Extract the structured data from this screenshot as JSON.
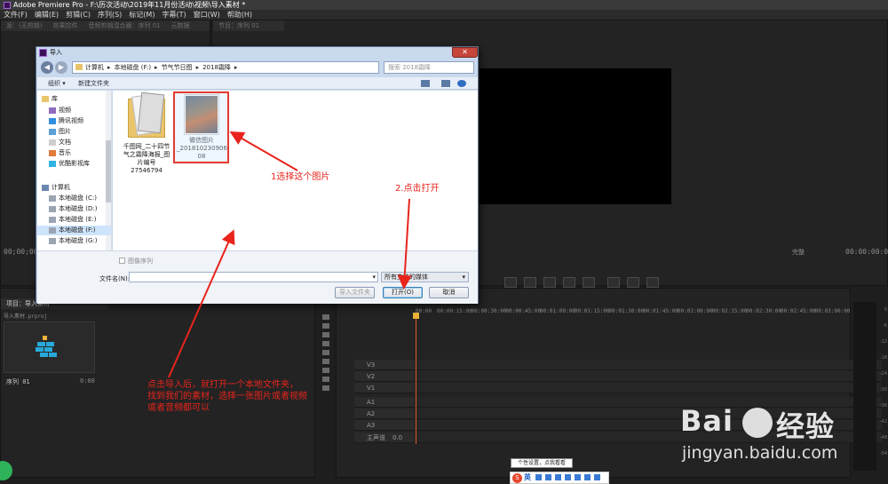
{
  "app": {
    "title": "Adobe Premiere Pro - F:\\历次活动\\2019年11月份活动\\视频\\导入素材 *",
    "menu": [
      "文件(F)",
      "编辑(E)",
      "剪辑(C)",
      "序列(S)",
      "标记(M)",
      "字幕(T)",
      "窗口(W)",
      "帮助(H)"
    ]
  },
  "premiere": {
    "source_tabs": [
      "源：(无剪辑)",
      "效果控件",
      "音频剪辑混合器：序列 01",
      "元数据"
    ],
    "program_tab": "节目：序列 01",
    "source_timecode": "00;00;00;00",
    "program_timecode_left": "00;00;00;00",
    "program_timecode_right": "00:00:00:00",
    "program_fit": "完整",
    "project_tab": "项目：导入素材",
    "project_item": "导入素材.prproj",
    "sequence_label": "序列 01",
    "sequence_duration": "0:00",
    "timeline_ruler": [
      "00:00",
      "00:00:15:00",
      "00:00:30:00",
      "00:00:45:00",
      "00:01:00:00",
      "00:01:15:00",
      "00:01:30:00",
      "00:01:45:00",
      "00:02:00:00",
      "00:02:15:00",
      "00:02:30:00",
      "00:02:45:00",
      "00:03:00:00"
    ],
    "tracks": [
      "V3",
      "V2",
      "V1",
      "A1",
      "A2",
      "A3",
      "主声道"
    ],
    "master_value": "0.0",
    "meter_db": [
      "0",
      "-6",
      "-12",
      "-18",
      "-24",
      "-30",
      "-36",
      "-42",
      "-48",
      "-54"
    ]
  },
  "dialog": {
    "title": "导入",
    "close": "✕",
    "back": "◀",
    "forward": "▶",
    "address": [
      "计算机",
      "▸",
      "本地磁盘 (F:)",
      "▸",
      "节气节日图",
      "▸",
      "2018霜降",
      "▸"
    ],
    "search_placeholder": "搜索 2018霜降",
    "organize": "组织 ▾",
    "new_folder": "新建文件夹",
    "nav": [
      {
        "label": "库",
        "icon": "library-icon"
      },
      {
        "label": "视频",
        "icon": "video-folder-icon"
      },
      {
        "label": "腾讯视频",
        "icon": "tencent-video-icon"
      },
      {
        "label": "图片",
        "icon": "pictures-icon"
      },
      {
        "label": "文档",
        "icon": "documents-icon"
      },
      {
        "label": "音乐",
        "icon": "music-icon"
      },
      {
        "label": "优酷影视库",
        "icon": "youku-icon"
      },
      {
        "label": "计算机",
        "icon": "computer-icon"
      },
      {
        "label": "本地磁盘 (C:)",
        "icon": "drive-icon"
      },
      {
        "label": "本地磁盘 (D:)",
        "icon": "drive-icon"
      },
      {
        "label": "本地磁盘 (E:)",
        "icon": "drive-icon"
      },
      {
        "label": "本地磁盘 (F:)",
        "icon": "drive-icon"
      },
      {
        "label": "本地磁盘 (G:)",
        "icon": "drive-icon"
      }
    ],
    "files": [
      {
        "name_lines": [
          "千图网_二十四节",
          "气之霜降海报_图",
          "片编号27546794"
        ],
        "kind": "folder"
      },
      {
        "name_lines": [
          "微信图片",
          "_201810230906",
          "08"
        ],
        "kind": "image"
      }
    ],
    "image_sequence_label": "图像序列",
    "filename_label": "文件名(N):",
    "filename_value": "",
    "filetype_value": "所有支持的媒体",
    "import_folder_btn": "导入文件夹",
    "open_btn": "打开(O)",
    "cancel_btn": "取消"
  },
  "annotations": {
    "step1": "1选择这个图片",
    "step2": "2.点击打开",
    "note_lines": [
      "点击导入后，就打开一个本地文件夹，",
      "找到我们的素材，选择一张图片或者视频",
      "或者音频都可以"
    ],
    "color": "#e8241c"
  },
  "watermark": {
    "brand": "Bai",
    "brand2": "经验",
    "url": "jingyan.baidu.com"
  },
  "taskbar": {
    "tooltip": "个性设置，点我看看",
    "ime_label": "英",
    "ime_logo": "S"
  }
}
